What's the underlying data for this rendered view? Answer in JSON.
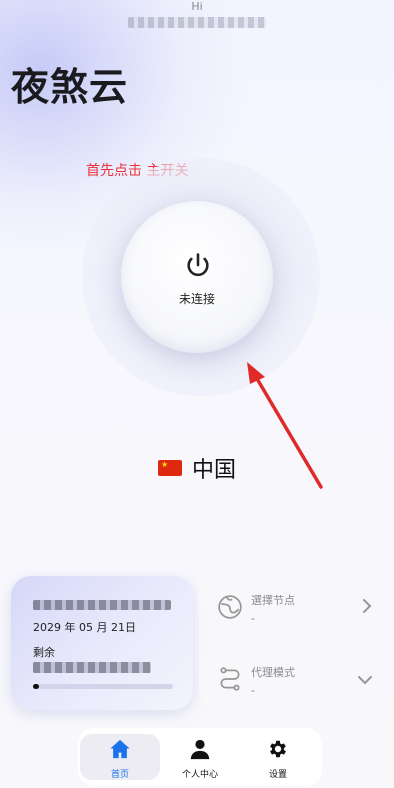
{
  "header": {
    "greeting": "Hi"
  },
  "app": {
    "title": "夜煞云"
  },
  "hint": {
    "text": "首先点击 主开关",
    "color": "#e8333b"
  },
  "power": {
    "status_label": "未连接",
    "icon": "power-icon"
  },
  "location": {
    "country": "中国",
    "flag": "china-flag"
  },
  "subscription": {
    "expire_date": "2029 年 05 月 21日",
    "remaining_label": "剩余",
    "usage_fraction": 0.0
  },
  "node": {
    "label": "選擇节点",
    "value": "-",
    "icon": "globe-icon"
  },
  "proxy_mode": {
    "label": "代理模式",
    "value": "-",
    "icon": "route-icon"
  },
  "nav": {
    "items": [
      {
        "label": "首页",
        "icon": "home-icon",
        "active": true
      },
      {
        "label": "个人中心",
        "icon": "user-icon",
        "active": false
      },
      {
        "label": "设置",
        "icon": "gear-icon",
        "active": false
      }
    ]
  },
  "colors": {
    "accent": "#1a73e8",
    "annotation_arrow": "#e02a2a"
  }
}
